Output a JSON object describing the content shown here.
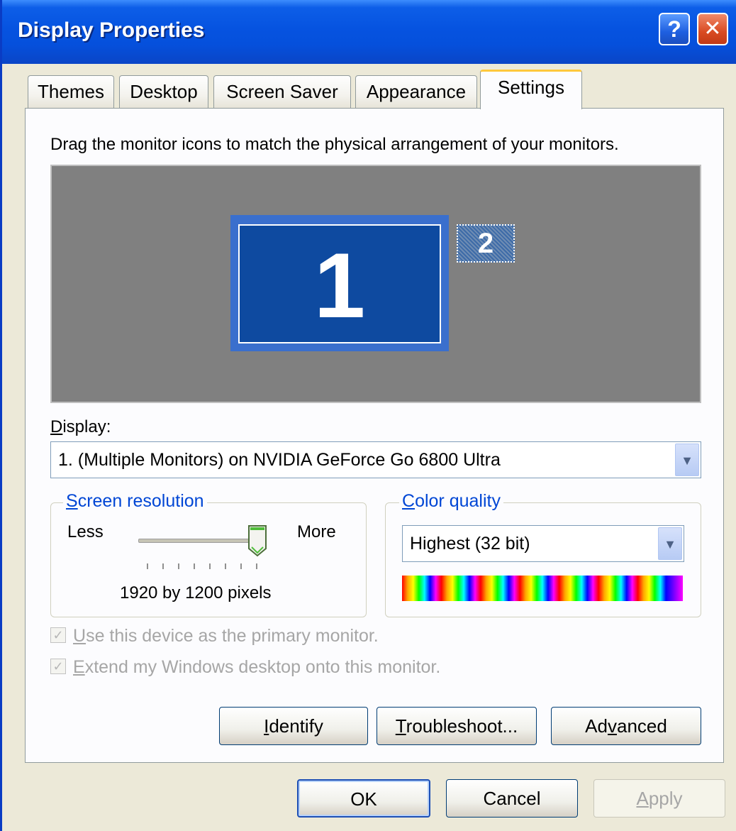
{
  "window": {
    "title": "Display Properties"
  },
  "titlebar": {
    "help_label": "?",
    "close_label": "✕"
  },
  "tabs": [
    {
      "label": "Themes"
    },
    {
      "label": "Desktop"
    },
    {
      "label": "Screen Saver"
    },
    {
      "label": "Appearance"
    },
    {
      "label": "Settings"
    }
  ],
  "active_tab": "Settings",
  "settings": {
    "instruction": "Drag the monitor icons to match the physical arrangement of your monitors.",
    "monitors": [
      {
        "label": "1",
        "selected": true
      },
      {
        "label": "2",
        "selected": false
      }
    ],
    "display_label_first": "D",
    "display_label_rest": "isplay:",
    "display_value": "1. (Multiple Monitors) on NVIDIA GeForce Go 6800 Ultra",
    "resolution": {
      "title_first": "S",
      "title_rest": "creen resolution",
      "less_label": "Less",
      "more_label": "More",
      "value_text": "1920 by 1200 pixels",
      "slider_position_fraction": 1.0
    },
    "color_quality": {
      "title_first": "C",
      "title_rest": "olor quality",
      "value": "Highest (32 bit)"
    },
    "checkboxes": [
      {
        "label_first": "U",
        "label_rest": "se this device as the primary monitor.",
        "checked": true,
        "enabled": false
      },
      {
        "label_first": "E",
        "label_rest": "xtend my Windows desktop onto this monitor.",
        "checked": true,
        "enabled": false
      }
    ],
    "buttons": {
      "identify_first": "I",
      "identify_rest": "dentify",
      "troubleshoot_first": "T",
      "troubleshoot_rest": "roubleshoot...",
      "advanced_pre": "Ad",
      "advanced_key": "v",
      "advanced_post": "anced"
    }
  },
  "footer": {
    "ok_label": "OK",
    "cancel_label": "Cancel",
    "apply_first": "A",
    "apply_rest": "pply"
  },
  "colors": {
    "titlebar": "#0653e0",
    "group_title": "#0046d5",
    "monitor_primary": "#0e4aa0",
    "preview_bg": "#808080"
  }
}
